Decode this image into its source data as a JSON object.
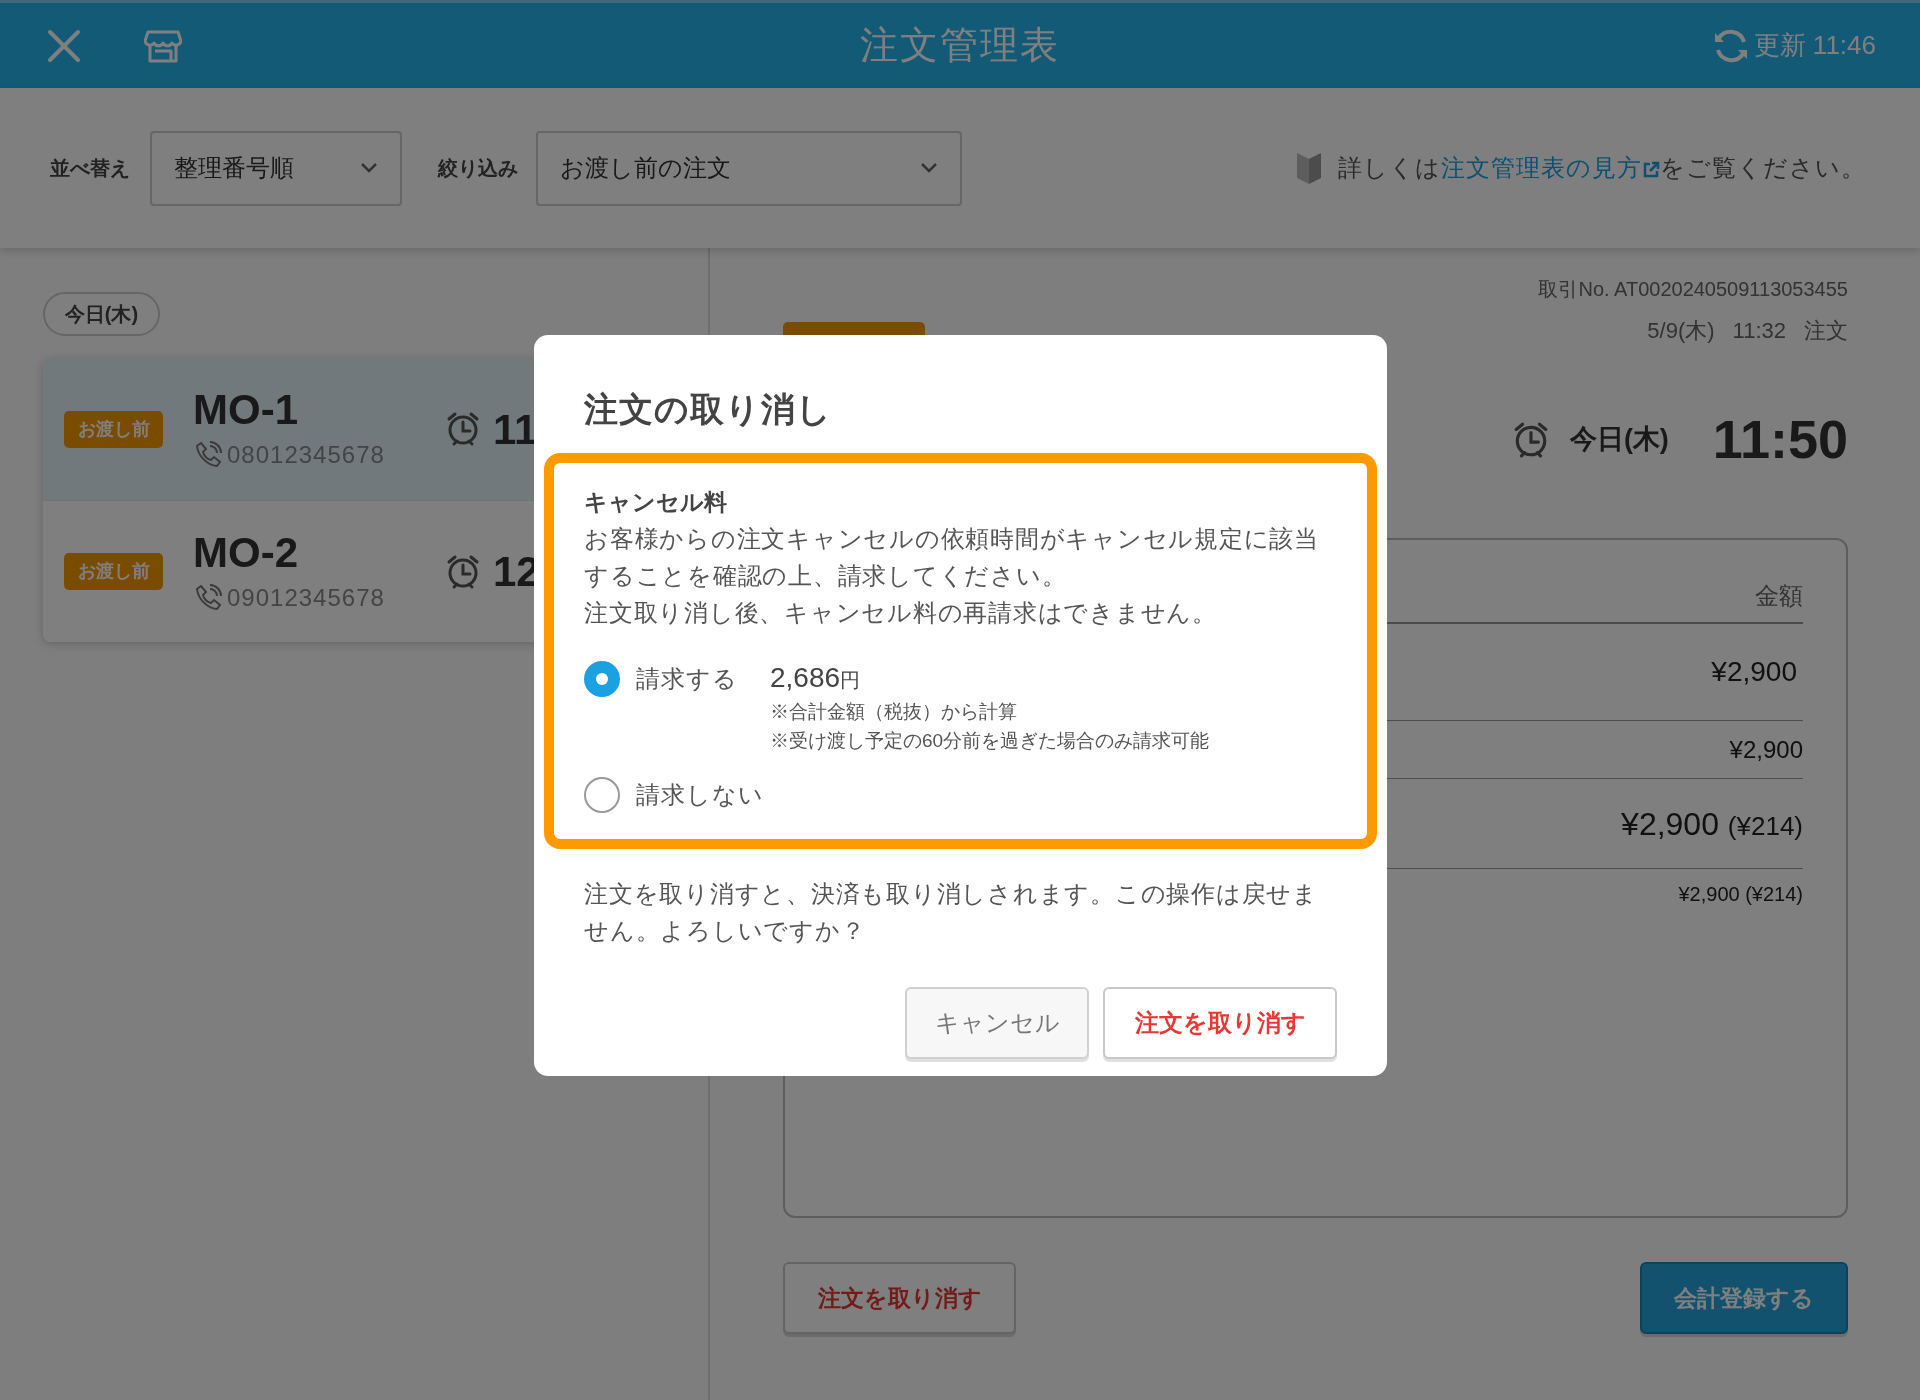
{
  "header": {
    "title": "注文管理表",
    "refresh": "更新 11:46"
  },
  "toolbar": {
    "sort_label": "並べ替え",
    "sort_value": "整理番号順",
    "filter_label": "絞り込み",
    "filter_value": "お渡し前の注文",
    "help": {
      "prefix": "詳しくは",
      "link": "注文管理表の見方",
      "suffix": "をご覧ください。"
    }
  },
  "order_list": {
    "date_chip": "今日(木)",
    "orders": [
      {
        "status": "お渡し前",
        "number": "MO-1",
        "phone": "08012345678",
        "time": "11",
        "selected": true
      },
      {
        "status": "お渡し前",
        "number": "MO-2",
        "phone": "09012345678",
        "time": "12",
        "selected": false
      }
    ]
  },
  "detail": {
    "transaction_no": "取引No. AT0020240509113053455",
    "ordered_at": [
      "5/9(木)",
      "11:32",
      "注文"
    ],
    "pickup_day": "今日(木)",
    "pickup_time": "11:50",
    "table": {
      "columns": [
        "金額"
      ],
      "rows": [
        {
          "kind": "item",
          "amount": "¥2,900"
        },
        {
          "kind": "subtotal",
          "amount": "¥2,900"
        },
        {
          "kind": "total",
          "amount": "¥2,900",
          "tax": "(¥214)"
        },
        {
          "kind": "breakdown",
          "amount": "¥2,900",
          "tax": "(¥214)"
        }
      ]
    },
    "buttons": [
      {
        "label": "注文を取り消す",
        "kind": "danger"
      },
      {
        "label": "会計登録する",
        "kind": "primary"
      }
    ]
  },
  "dialog": {
    "title": "注文の取り消し",
    "fee": {
      "heading": "キャンセル料",
      "paragraphs": [
        "お客様からの注文キャンセルの依頼時間がキャンセル規定に該当することを確認の上、請求してください。",
        "注文取り消し後、キャンセル料の再請求はできません。"
      ],
      "options": [
        {
          "label": "請求する",
          "selected": true,
          "amount": "2,686",
          "unit": "円",
          "notes": [
            "※合計金額（税抜）から計算",
            "※受け渡し予定の60分前を過ぎた場合のみ請求可能"
          ]
        },
        {
          "label": "請求しない",
          "selected": false
        }
      ]
    },
    "message": "注文を取り消すと、決済も取り消しされます。この操作は戻せません。よろしいですか？",
    "buttons": [
      {
        "label": "キャンセル",
        "kind": "secondary"
      },
      {
        "label": "注文を取り消す",
        "kind": "danger"
      }
    ]
  }
}
